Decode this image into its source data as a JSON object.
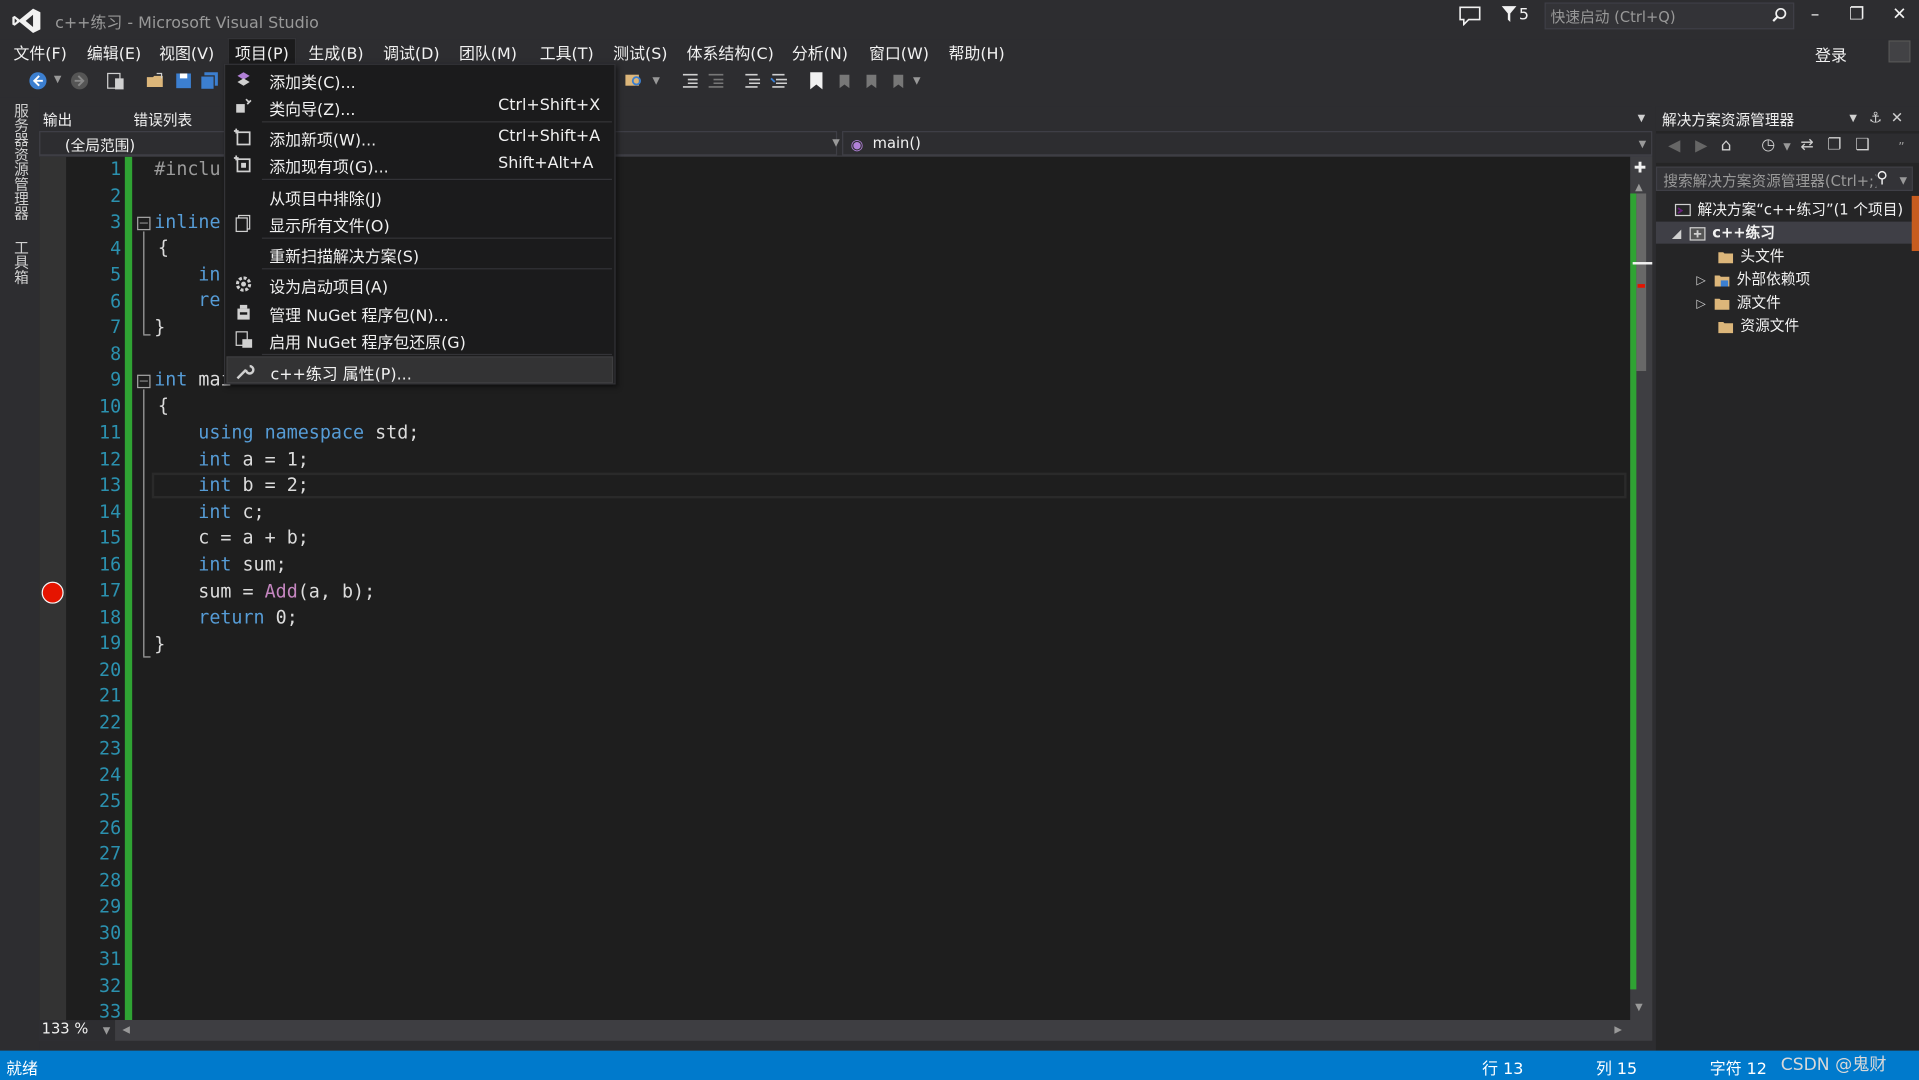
{
  "window": {
    "title": "c++练习 - Microsoft Visual Studio",
    "notifications": "5",
    "quick_launch_placeholder": "快速启动 (Ctrl+Q)",
    "login": "登录"
  },
  "menubar": {
    "items": [
      "文件(F)",
      "编辑(E)",
      "视图(V)",
      "项目(P)",
      "生成(B)",
      "调试(D)",
      "团队(M)",
      "工具(T)",
      "测试(S)",
      "体系结构(C)",
      "分析(N)",
      "窗口(W)",
      "帮助(H)"
    ],
    "active": "项目(P)"
  },
  "left_rail": {
    "tabs": [
      "服务器资源管理器",
      "工具箱"
    ]
  },
  "doc_tabs": [
    "输出",
    "错误列表"
  ],
  "navbar": {
    "scope": "(全局范围)",
    "member": "main()"
  },
  "editor": {
    "zoom": "133 %",
    "lines": [
      {
        "n": "1",
        "code": "#include <iostream>"
      },
      {
        "n": "2",
        "code": ""
      },
      {
        "n": "3",
        "code": "inline int Add(int x, int y)"
      },
      {
        "n": "4",
        "code": "{"
      },
      {
        "n": "5",
        "code": "    int ret = x + y;"
      },
      {
        "n": "6",
        "code": "    return ret;"
      },
      {
        "n": "7",
        "code": "}"
      },
      {
        "n": "8",
        "code": ""
      },
      {
        "n": "9",
        "code": "int main()"
      },
      {
        "n": "10",
        "code": "{"
      },
      {
        "n": "11",
        "code": "    using namespace std;"
      },
      {
        "n": "12",
        "code": "    int a = 1;"
      },
      {
        "n": "13",
        "code": "    int b = 2;"
      },
      {
        "n": "14",
        "code": "    int c;"
      },
      {
        "n": "15",
        "code": "    c = a + b;"
      },
      {
        "n": "16",
        "code": "    int sum;"
      },
      {
        "n": "17",
        "code": "    sum = Add(a, b);"
      },
      {
        "n": "18",
        "code": "    return 0;"
      },
      {
        "n": "19",
        "code": "}"
      },
      {
        "n": "20",
        "code": ""
      },
      {
        "n": "21",
        "code": ""
      },
      {
        "n": "22",
        "code": ""
      },
      {
        "n": "23",
        "code": ""
      },
      {
        "n": "24",
        "code": ""
      },
      {
        "n": "25",
        "code": ""
      },
      {
        "n": "26",
        "code": ""
      },
      {
        "n": "27",
        "code": ""
      },
      {
        "n": "28",
        "code": ""
      },
      {
        "n": "29",
        "code": ""
      },
      {
        "n": "30",
        "code": ""
      },
      {
        "n": "31",
        "code": ""
      },
      {
        "n": "32",
        "code": ""
      },
      {
        "n": "33",
        "code": ""
      }
    ],
    "visible_code": {
      "l1": "#inclu",
      "l3_kw": "inline",
      "l5": "in",
      "l6": "re",
      "l9_kw": "int",
      "l9_rest": " mai",
      "l11_kw1": "using",
      "l11_kw2": "namespace",
      "l11_rest": " std;",
      "l12_rest": " a = 1;",
      "l13_rest": " b = 2;",
      "l14_rest": " c;",
      "l15": "c = a + b;",
      "l16_rest": " sum;",
      "l17_pre": "sum = ",
      "l17_fn": "Add",
      "l17_post": "(a, b);",
      "l18_kw": "return",
      "l18_rest": " 0;",
      "brace_open": "{",
      "brace_close": "}",
      "kw_int": "int"
    }
  },
  "dropdown": {
    "items": [
      {
        "label": "添加类(C)...",
        "shortcut": "",
        "icon": "add-class-icon"
      },
      {
        "label": "类向导(Z)...",
        "shortcut": "Ctrl+Shift+X",
        "icon": "class-wizard-icon"
      },
      {
        "label": "添加新项(W)...",
        "shortcut": "Ctrl+Shift+A",
        "icon": "add-new-item-icon"
      },
      {
        "label": "添加现有项(G)...",
        "shortcut": "Shift+Alt+A",
        "icon": "add-existing-item-icon"
      },
      {
        "label": "从项目中排除(J)",
        "shortcut": "",
        "icon": ""
      },
      {
        "label": "显示所有文件(O)",
        "shortcut": "",
        "icon": "show-all-files-icon"
      },
      {
        "label": "重新扫描解决方案(S)",
        "shortcut": "",
        "icon": ""
      },
      {
        "label": "设为启动项目(A)",
        "shortcut": "",
        "icon": "gear-icon"
      },
      {
        "label": "管理 NuGet 程序包(N)...",
        "shortcut": "",
        "icon": "nuget-icon"
      },
      {
        "label": "启用 NuGet 程序包还原(G)",
        "shortcut": "",
        "icon": "nuget-restore-icon"
      },
      {
        "label": "c++练习 属性(P)...",
        "shortcut": "",
        "icon": "wrench-icon"
      }
    ]
  },
  "solution_explorer": {
    "title": "解决方案资源管理器",
    "search_placeholder": "搜索解决方案资源管理器(Ctrl+;)",
    "solution": "解决方案“c++练习”(1 个项目)",
    "project": "c++练习",
    "folders": [
      "头文件",
      "外部依赖项",
      "源文件",
      "资源文件"
    ]
  },
  "statusbar": {
    "ready": "就绪",
    "line": "行 13",
    "col": "列 15",
    "char": "字符 12",
    "watermark": "CSDN @鬼财"
  },
  "colors": {
    "accent": "#007acc",
    "breakpoint": "#e51400",
    "change_bar": "#2fa333",
    "keyword": "#569cd6",
    "line_number": "#2b91af",
    "function_name": "#c8c8c8"
  }
}
